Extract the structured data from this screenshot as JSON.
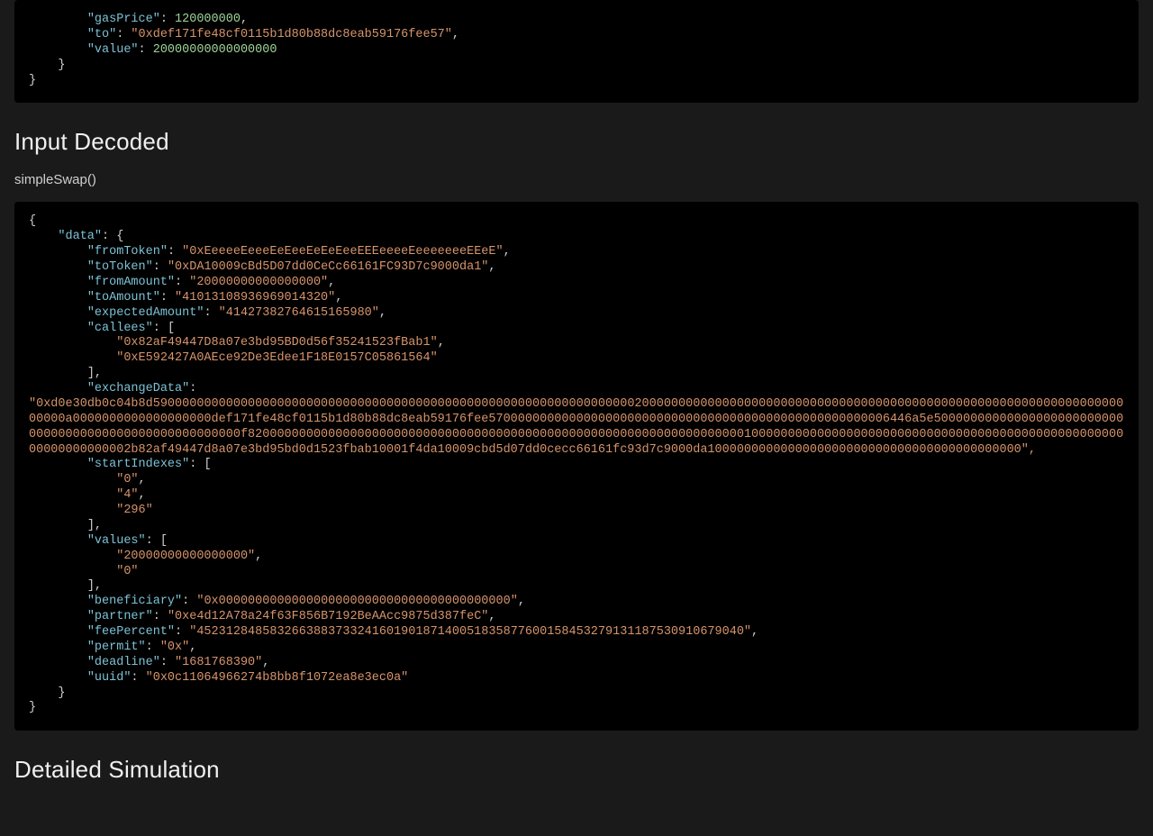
{
  "top_tx": {
    "gasPrice_key": "\"gasPrice\"",
    "gasPrice_val": "120000000",
    "to_key": "\"to\"",
    "to_val": "\"0xdef171fe48cf0115b1d80b88dc8eab59176fee57\"",
    "value_key": "\"value\"",
    "value_val": "20000000000000000"
  },
  "section_input_decoded": {
    "heading": "Input Decoded",
    "function_name": "simpleSwap()"
  },
  "decoded": {
    "open_brace": "{",
    "data_key": "\"data\"",
    "data_open": "{",
    "fromToken_key": "\"fromToken\"",
    "fromToken_val": "\"0xEeeeeEeeeEeEeeEeEeEeeEEEeeeeEeeeeeeeEEeE\"",
    "toToken_key": "\"toToken\"",
    "toToken_val": "\"0xDA10009cBd5D07dd0CeCc66161FC93D7c9000da1\"",
    "fromAmount_key": "\"fromAmount\"",
    "fromAmount_val": "\"20000000000000000\"",
    "toAmount_key": "\"toAmount\"",
    "toAmount_val": "\"41013108936969014320\"",
    "expectedAmount_key": "\"expectedAmount\"",
    "expectedAmount_val": "\"41427382764615165980\"",
    "callees_key": "\"callees\"",
    "callees_open": "[",
    "callee0": "\"0x82aF49447D8a07e3bd95BD0d56f35241523fBab1\"",
    "callee1": "\"0xE592427A0AEce92De3Edee1F18E0157C05861564\"",
    "callees_close": "],",
    "exchangeData_key": "\"exchangeData\"",
    "exchangeData_val_open": "\"",
    "exchangeData_val_body": "0xd0e30db0c04b8d590000000000000000000000000000000000000000000000000000000000000000200000000000000000000000000000000000000000000000000000000000000000000000a0000000000000000000def171fe48cf0115b1d80b88dc8eab59176fee5700000000000000000000000000000000000000000000000000006446a5e5000000000000000000000000000000000000000000000000000000f82000000000000000000000000000000000000000000000000000000000000000000100000000000000000000000000000000000000000000000000000000000000002b82af49447d8a07e3bd95bd0d1523fbab10001f4da10009cbd5d07dd0cecc66161fc93d7c9000da1000000000000000000000000000000000000000000",
    "exchangeData_val_close": "\",",
    "startIndexes_key": "\"startIndexes\"",
    "startIndexes_open": "[",
    "si0": "\"0\"",
    "si1": "\"4\"",
    "si2": "\"296\"",
    "startIndexes_close": "],",
    "values_key": "\"values\"",
    "values_open": "[",
    "val0": "\"20000000000000000\"",
    "val1": "\"0\"",
    "values_close": "],",
    "beneficiary_key": "\"beneficiary\"",
    "beneficiary_val": "\"0x0000000000000000000000000000000000000000\"",
    "partner_key": "\"partner\"",
    "partner_val": "\"0xe4d12A78a24f63F856B7192BeAAcc9875d387feC\"",
    "feePercent_key": "\"feePercent\"",
    "feePercent_val": "\"452312848583266388373324160190187140051835877600158453279131187530910679040\"",
    "permit_key": "\"permit\"",
    "permit_val": "\"0x\"",
    "deadline_key": "\"deadline\"",
    "deadline_val": "\"1681768390\"",
    "uuid_key": "\"uuid\"",
    "uuid_val": "\"0x0c11064966274b8bb8f1072ea8e3ec0a\"",
    "data_close": "}",
    "close_brace": "}"
  },
  "section_detailed_sim": {
    "heading": "Detailed Simulation"
  }
}
